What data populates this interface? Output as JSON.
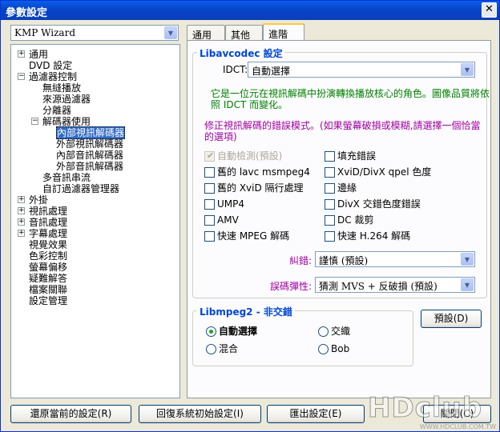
{
  "window": {
    "title": "參數設定",
    "close": "✕"
  },
  "preset": {
    "value": "KMP Wizard"
  },
  "tree": [
    {
      "label": "通用",
      "expander": "+"
    },
    {
      "label": "DVD 設定",
      "expander": ""
    },
    {
      "label": "過濾器控制",
      "expander": "−"
    },
    {
      "label": "無縫播放",
      "expander": ""
    },
    {
      "label": "來源過濾器",
      "expander": ""
    },
    {
      "label": "分離器",
      "expander": ""
    },
    {
      "label": "解碼器使用",
      "expander": "−"
    },
    {
      "label": "內部視訊解碼器",
      "expander": ""
    },
    {
      "label": "外部視訊解碼器",
      "expander": ""
    },
    {
      "label": "內部音訊解碼器",
      "expander": ""
    },
    {
      "label": "外部音訊解碼器",
      "expander": ""
    },
    {
      "label": "多音訊串流",
      "expander": ""
    },
    {
      "label": "自訂過濾器管理器",
      "expander": ""
    },
    {
      "label": "外掛",
      "expander": "+"
    },
    {
      "label": "視訊處理",
      "expander": "+"
    },
    {
      "label": "音訊處理",
      "expander": "+"
    },
    {
      "label": "字幕處理",
      "expander": "+"
    },
    {
      "label": "視覺效果",
      "expander": ""
    },
    {
      "label": "色彩控制",
      "expander": ""
    },
    {
      "label": "螢幕偏移",
      "expander": ""
    },
    {
      "label": "疑難解答",
      "expander": ""
    },
    {
      "label": "檔案關聯",
      "expander": ""
    },
    {
      "label": "設定管理",
      "expander": ""
    }
  ],
  "tabs": [
    "通用",
    "其他",
    "進階"
  ],
  "libavcodec": {
    "title": "Libavcodec 設定",
    "idct_label": "IDCT:",
    "idct_value": "自動選擇",
    "desc1": "它是一位元在視訊解碼中扮演轉換播放核心的角色。圖像品質將依",
    "desc2": "照 IDCT 而變化。",
    "err1": "修正視訊解碼的錯誤模式。(如果螢幕破損或模糊,請選擇一個恰當",
    "err2": "的選項)",
    "checks_left": [
      "自動檢測(預設)",
      "舊的 lavc msmpeg4",
      "舊的 XviD 隔行處理",
      "UMP4",
      "AMV",
      "快速 MPEG 解碼"
    ],
    "checks_right": [
      "填充錯誤",
      "XviD/DivX qpel 色度",
      "邊緣",
      "DivX 交錯色度錯誤",
      "DC 裁剪",
      "快速 H.264 解碼"
    ],
    "correct_label": "糾錯:",
    "correct_value": "謹慎 (預設)",
    "resil_label": "誤碼彈性:",
    "resil_value": "猜測 MVS + 反破損 (預設)"
  },
  "libmpeg2": {
    "title": "Libmpeg2 - 非交錯",
    "radios": [
      "自動選擇",
      "交織",
      "混合",
      "Bob"
    ],
    "default_button": "預設(D)"
  },
  "buttons": {
    "restore": "還原當前的設定(R)",
    "reset": "回復系統初始設定(I)",
    "export": "匯出設定(E)",
    "close": "關閉(C)"
  },
  "watermark": {
    "text": "HDclub",
    "sub": "WWW.HDCLUB.COM.TW"
  }
}
